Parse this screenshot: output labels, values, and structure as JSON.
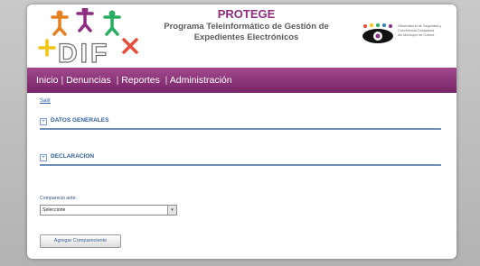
{
  "header": {
    "app_name": "PROTEGE",
    "subtitle_line1": "Programa Teleinformático de Gestión de",
    "subtitle_line2": "Expedientes Electrónicos",
    "logo_text": "DIF",
    "observatory_line1": "Observatorio de Seguridad y",
    "observatory_line2": "Convivencia Ciudadana",
    "observatory_line3": "del Municipio de Colima"
  },
  "nav": {
    "items": [
      "Inicio",
      "Denuncias",
      "Reportes",
      "Administración"
    ],
    "separator": "|"
  },
  "content": {
    "logout_link": "Salir",
    "sections": [
      {
        "label": "DATOS GENERALES",
        "toggle": "+"
      },
      {
        "label": "DECLARACION",
        "toggle": "+"
      }
    ],
    "field_label": "Comparecio ante:",
    "select_value": "Seleccione",
    "select_arrow": "▾",
    "add_button": "Agregar Compareciente"
  },
  "colors": {
    "nav_bg": "#8e2d80",
    "brand_purple": "#8e2d80",
    "section_blue": "#2f5f97"
  }
}
